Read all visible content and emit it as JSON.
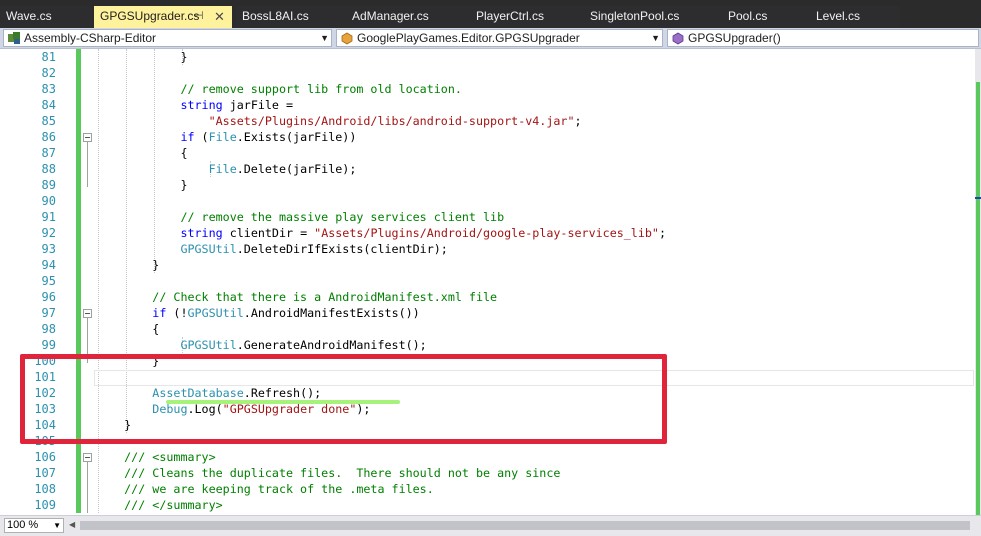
{
  "tabs": [
    {
      "label": "Wave.cs"
    },
    {
      "label": "GPGSUpgrader.cs",
      "pin": "⊣",
      "close": "✕"
    },
    {
      "label": "BossL8AI.cs"
    },
    {
      "label": "AdManager.cs"
    },
    {
      "label": "PlayerCtrl.cs"
    },
    {
      "label": "SingletonPool.cs"
    },
    {
      "label": "Pool.cs"
    },
    {
      "label": "Level.cs"
    }
  ],
  "nav": {
    "project": "Assembly-CSharp-Editor",
    "type": "GooglePlayGames.Editor.GPGSUpgrader",
    "member": "GPGSUpgrader()",
    "dropdown_glyph": "▼"
  },
  "zoom": {
    "value": "100 %",
    "dropdown_glyph": "▼"
  },
  "scroll_left_glyph": "◀",
  "colors": {
    "keyword": "#0000ff",
    "type": "#2b91af",
    "string": "#a31515",
    "comment": "#008000",
    "change_bar": "#5ac85a",
    "annotation_box": "#e0243c",
    "annotation_underline": "#a6f27a",
    "active_tab": "#fff29d"
  },
  "icons": {
    "project": "project-icon",
    "type": "class-icon",
    "member": "method-icon"
  },
  "lines": [
    {
      "n": "81",
      "tokens": [
        [
          "pl",
          "            }"
        ]
      ]
    },
    {
      "n": "82",
      "tokens": []
    },
    {
      "n": "83",
      "tokens": [
        [
          "cm",
          "            // remove support lib from old location."
        ]
      ]
    },
    {
      "n": "84",
      "tokens": [
        [
          "kw",
          "            string"
        ],
        [
          "pl",
          " jarFile ="
        ]
      ]
    },
    {
      "n": "85",
      "tokens": [
        [
          "st",
          "                \"Assets/Plugins/Android/libs/android-support-v4.jar\""
        ],
        [
          "pl",
          ";"
        ]
      ]
    },
    {
      "n": "86",
      "tokens": [
        [
          "kw",
          "            if"
        ],
        [
          "pl",
          " ("
        ],
        [
          "ty",
          "File"
        ],
        [
          "pl",
          ".Exists(jarFile))"
        ]
      ]
    },
    {
      "n": "87",
      "tokens": [
        [
          "pl",
          "            {"
        ]
      ]
    },
    {
      "n": "88",
      "tokens": [
        [
          "ty",
          "                File"
        ],
        [
          "pl",
          ".Delete(jarFile);"
        ]
      ]
    },
    {
      "n": "89",
      "tokens": [
        [
          "pl",
          "            }"
        ]
      ]
    },
    {
      "n": "90",
      "tokens": []
    },
    {
      "n": "91",
      "tokens": [
        [
          "cm",
          "            // remove the massive play services client lib"
        ]
      ]
    },
    {
      "n": "92",
      "tokens": [
        [
          "kw",
          "            string"
        ],
        [
          "pl",
          " clientDir = "
        ],
        [
          "st",
          "\"Assets/Plugins/Android/google-play-services_lib\""
        ],
        [
          "pl",
          ";"
        ]
      ]
    },
    {
      "n": "93",
      "tokens": [
        [
          "ty",
          "            GPGSUtil"
        ],
        [
          "pl",
          ".DeleteDirIfExists(clientDir);"
        ]
      ]
    },
    {
      "n": "94",
      "tokens": [
        [
          "pl",
          "        }"
        ]
      ]
    },
    {
      "n": "95",
      "tokens": []
    },
    {
      "n": "96",
      "tokens": [
        [
          "cm",
          "        // Check that there is a AndroidManifest.xml file"
        ]
      ]
    },
    {
      "n": "97",
      "tokens": [
        [
          "kw",
          "        if"
        ],
        [
          "pl",
          " (!"
        ],
        [
          "ty",
          "GPGSUtil"
        ],
        [
          "pl",
          ".AndroidManifestExists())"
        ]
      ]
    },
    {
      "n": "98",
      "tokens": [
        [
          "pl",
          "        {"
        ]
      ]
    },
    {
      "n": "99",
      "tokens": [
        [
          "ty",
          "            GPGSUtil"
        ],
        [
          "pl",
          ".GenerateAndroidManifest();"
        ]
      ]
    },
    {
      "n": "100",
      "tokens": [
        [
          "pl",
          "        }"
        ]
      ]
    },
    {
      "n": "101",
      "tokens": []
    },
    {
      "n": "102",
      "tokens": [
        [
          "ty",
          "        AssetDatabase"
        ],
        [
          "pl",
          ".Refresh();"
        ]
      ]
    },
    {
      "n": "103",
      "tokens": [
        [
          "ty",
          "        Debug"
        ],
        [
          "pl",
          ".Log("
        ],
        [
          "st",
          "\"GPGSUpgrader done\""
        ],
        [
          "pl",
          ");"
        ]
      ]
    },
    {
      "n": "104",
      "tokens": [
        [
          "pl",
          "    }"
        ]
      ]
    },
    {
      "n": "105",
      "tokens": []
    },
    {
      "n": "106",
      "tokens": [
        [
          "cm",
          "    /// <summary>"
        ]
      ]
    },
    {
      "n": "107",
      "tokens": [
        [
          "cm",
          "    /// Cleans the duplicate files.  There should not be any since"
        ]
      ]
    },
    {
      "n": "108",
      "tokens": [
        [
          "cm",
          "    /// we are keeping track of the .meta files."
        ]
      ]
    },
    {
      "n": "109",
      "tokens": [
        [
          "cm",
          "    /// </summary>"
        ]
      ]
    }
  ]
}
